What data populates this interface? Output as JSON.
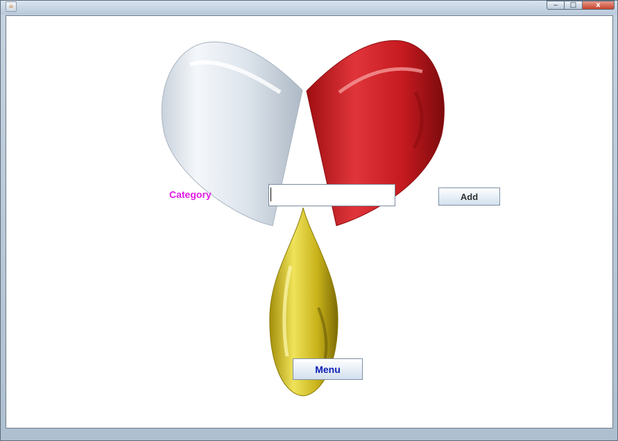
{
  "window": {
    "icon": "java-cup-icon",
    "controls": {
      "minimize": "‒",
      "maximize": "□",
      "close": "x"
    }
  },
  "form": {
    "category_label": "Category",
    "category_value": "",
    "add_button": "Add",
    "menu_button": "Menu"
  },
  "colors": {
    "label": "#e21ae6",
    "menu_text": "#0a1fb4",
    "capsule_white": "#dfe6ee",
    "capsule_red": "#c8181c",
    "drop_yellow": "#d8c81c"
  }
}
